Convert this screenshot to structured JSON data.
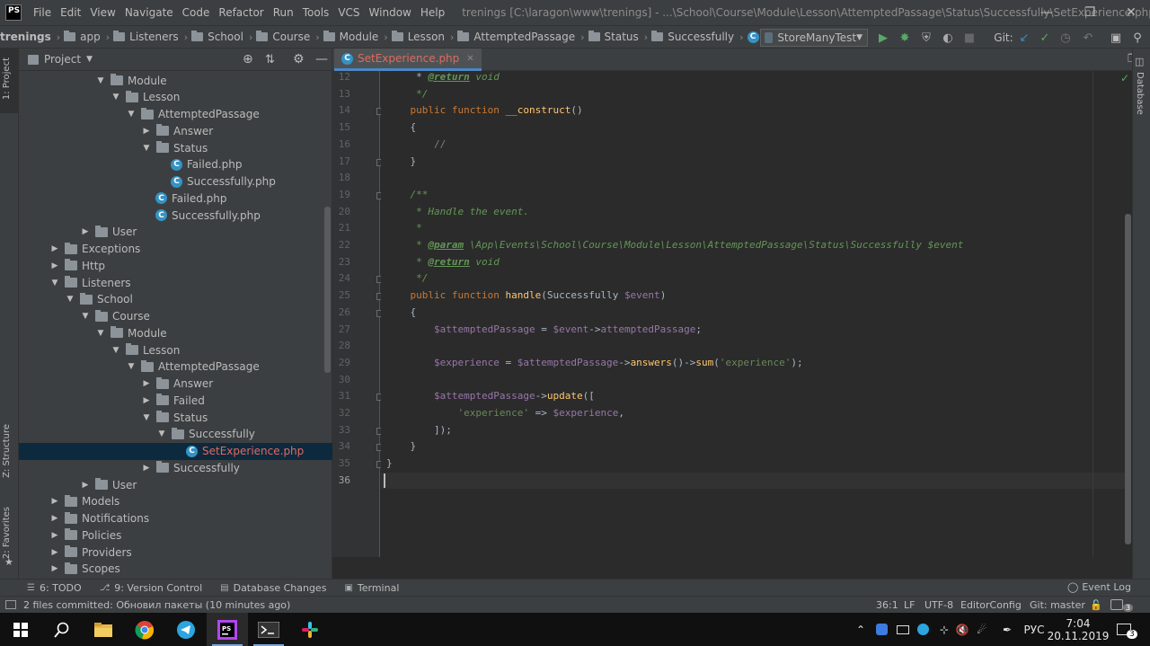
{
  "app": {
    "logo_text": "PS"
  },
  "menu": [
    "File",
    "Edit",
    "View",
    "Navigate",
    "Code",
    "Refactor",
    "Run",
    "Tools",
    "VCS",
    "Window",
    "Help"
  ],
  "window_title": "trenings [C:\\laragon\\www\\trenings] - ...\\School\\Course\\Module\\Lesson\\AttemptedPassage\\Status\\Successfully\\SetExperience.php",
  "breadcrumbs": [
    "trenings",
    "app",
    "Listeners",
    "School",
    "Course",
    "Module",
    "Lesson",
    "AttemptedPassage",
    "Status",
    "Successfully",
    "SetExperience.php"
  ],
  "toolbar": {
    "run_config": "StoreManyTest",
    "git_label": "Git:"
  },
  "side_tabs": {
    "project": "1: Project",
    "structure": "Z: Structure",
    "favorites": "2: Favorites",
    "database": "Database"
  },
  "project_panel": {
    "title": "Project",
    "tree": [
      {
        "label": "Module",
        "indent": 5,
        "arrow": "down",
        "icon": "folder"
      },
      {
        "label": "Lesson",
        "indent": 6,
        "arrow": "down",
        "icon": "folder"
      },
      {
        "label": "AttemptedPassage",
        "indent": 7,
        "arrow": "down",
        "icon": "folder"
      },
      {
        "label": "Answer",
        "indent": 8,
        "arrow": "right",
        "icon": "folder"
      },
      {
        "label": "Status",
        "indent": 8,
        "arrow": "down",
        "icon": "folder"
      },
      {
        "label": "Failed.php",
        "indent": 9,
        "arrow": "",
        "icon": "php"
      },
      {
        "label": "Successfully.php",
        "indent": 9,
        "arrow": "",
        "icon": "php"
      },
      {
        "label": "Failed.php",
        "indent": 8,
        "arrow": "",
        "icon": "php"
      },
      {
        "label": "Successfully.php",
        "indent": 8,
        "arrow": "",
        "icon": "php"
      },
      {
        "label": "User",
        "indent": 4,
        "arrow": "right",
        "icon": "folder"
      },
      {
        "label": "Exceptions",
        "indent": 2,
        "arrow": "right",
        "icon": "folder"
      },
      {
        "label": "Http",
        "indent": 2,
        "arrow": "right",
        "icon": "folder"
      },
      {
        "label": "Listeners",
        "indent": 2,
        "arrow": "down",
        "icon": "folder"
      },
      {
        "label": "School",
        "indent": 3,
        "arrow": "down",
        "icon": "folder"
      },
      {
        "label": "Course",
        "indent": 4,
        "arrow": "down",
        "icon": "folder"
      },
      {
        "label": "Module",
        "indent": 5,
        "arrow": "down",
        "icon": "folder"
      },
      {
        "label": "Lesson",
        "indent": 6,
        "arrow": "down",
        "icon": "folder"
      },
      {
        "label": "AttemptedPassage",
        "indent": 7,
        "arrow": "down",
        "icon": "folder"
      },
      {
        "label": "Answer",
        "indent": 8,
        "arrow": "right",
        "icon": "folder"
      },
      {
        "label": "Failed",
        "indent": 8,
        "arrow": "right",
        "icon": "folder"
      },
      {
        "label": "Status",
        "indent": 8,
        "arrow": "down",
        "icon": "folder"
      },
      {
        "label": "Successfully",
        "indent": 9,
        "arrow": "down",
        "icon": "folder"
      },
      {
        "label": "SetExperience.php",
        "indent": 10,
        "arrow": "",
        "icon": "php",
        "selected": true
      },
      {
        "label": "Successfully",
        "indent": 8,
        "arrow": "right",
        "icon": "folder"
      },
      {
        "label": "User",
        "indent": 4,
        "arrow": "right",
        "icon": "folder"
      },
      {
        "label": "Models",
        "indent": 2,
        "arrow": "right",
        "icon": "folder"
      },
      {
        "label": "Notifications",
        "indent": 2,
        "arrow": "right",
        "icon": "folder"
      },
      {
        "label": "Policies",
        "indent": 2,
        "arrow": "right",
        "icon": "folder"
      },
      {
        "label": "Providers",
        "indent": 2,
        "arrow": "right",
        "icon": "folder"
      },
      {
        "label": "Scopes",
        "indent": 2,
        "arrow": "right",
        "icon": "folder"
      }
    ]
  },
  "editor": {
    "tab_label": "SetExperience.php",
    "current_line": 36,
    "lines": [
      {
        "n": "12",
        "html": "     * <span class=\"tag\">@return</span><span class=\"cmt\"> void</span>"
      },
      {
        "n": "13",
        "html": "<span class=\"cmt\">     */</span>"
      },
      {
        "n": "14",
        "html": "    <span class=\"kw\">public function</span> <span class=\"fn\">__construct</span>()"
      },
      {
        "n": "15",
        "html": "    {"
      },
      {
        "n": "16",
        "html": "        <span class=\"lc\">//</span>"
      },
      {
        "n": "17",
        "html": "    }"
      },
      {
        "n": "18",
        "html": ""
      },
      {
        "n": "19",
        "html": "<span class=\"cmt\">    /**</span>"
      },
      {
        "n": "20",
        "html": "<span class=\"cmt\">     * Handle the event.</span>"
      },
      {
        "n": "21",
        "html": "<span class=\"cmt\">     *</span>"
      },
      {
        "n": "22",
        "html": "<span class=\"cmt\">     * </span><span class=\"tag\">@param</span><span class=\"cmt\"> \\App\\Events\\School\\Course\\Module\\Lesson\\AttemptedPassage\\Status\\Successfully $event</span>"
      },
      {
        "n": "23",
        "html": "<span class=\"cmt\">     * </span><span class=\"tag\">@return</span><span class=\"cmt\"> void</span>"
      },
      {
        "n": "24",
        "html": "<span class=\"cmt\">     */</span>"
      },
      {
        "n": "25",
        "html": "    <span class=\"kw\">public function</span> <span class=\"fn\">handle</span>(Successfully <span class=\"var\">$event</span>)"
      },
      {
        "n": "26",
        "html": "    {"
      },
      {
        "n": "27",
        "html": "        <span class=\"var\">$attemptedPassage</span> = <span class=\"var\">$event</span>-><span class=\"var\">attemptedPassage</span>;"
      },
      {
        "n": "28",
        "html": ""
      },
      {
        "n": "29",
        "html": "        <span class=\"var\">$experience</span> = <span class=\"var\">$attemptedPassage</span>-><span class=\"fn\">answers</span>()-><span class=\"fn\">sum</span>(<span class=\"str\">'experience'</span>);"
      },
      {
        "n": "30",
        "html": ""
      },
      {
        "n": "31",
        "html": "        <span class=\"var\">$attemptedPassage</span>-><span class=\"fn\">update</span>(["
      },
      {
        "n": "32",
        "html": "            <span class=\"str\">'experience'</span> => <span class=\"var\">$experience</span>,"
      },
      {
        "n": "33",
        "html": "        ]);"
      },
      {
        "n": "34",
        "html": "    }"
      },
      {
        "n": "35",
        "html": "}"
      },
      {
        "n": "36",
        "html": ""
      }
    ]
  },
  "bottom_tools": [
    {
      "label": "6: TODO",
      "icon": "todo-icon"
    },
    {
      "label": "9: Version Control",
      "icon": "version-control-icon"
    },
    {
      "label": "Database Changes",
      "icon": "database-changes-icon"
    },
    {
      "label": "Terminal",
      "icon": "terminal-icon"
    }
  ],
  "event_log": "Event Log",
  "event_log_count": "3",
  "status": {
    "message": "2 files committed: Обновил пакеты (10 minutes ago)",
    "position": "36:1",
    "line_sep": "LF",
    "encoding": "UTF-8",
    "editor_config": "EditorConfig",
    "git_branch": "Git: master"
  },
  "taskbar": {
    "lang": "РУС",
    "time": "7:04",
    "date": "20.11.2019",
    "notif_count": "3"
  }
}
